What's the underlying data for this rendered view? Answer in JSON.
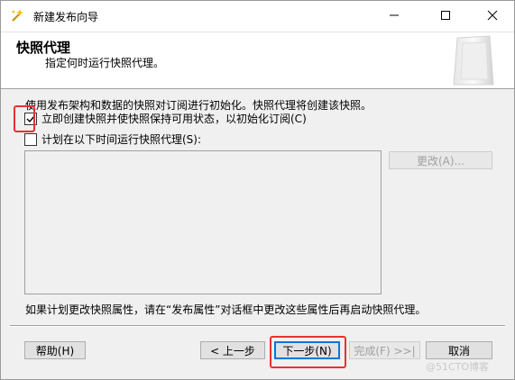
{
  "window": {
    "title": "新建发布向导"
  },
  "titlebar": {
    "minimize_glyph": "—",
    "maximize_glyph": "☐",
    "close_glyph": "✕"
  },
  "header": {
    "title": "快照代理",
    "subtitle": "指定何时运行快照代理。"
  },
  "body": {
    "description": "使用发布架构和数据的快照对订阅进行初始化。快照代理将创建该快照。",
    "options": [
      {
        "label": "立即创建快照并使快照保持可用状态，以初始化订阅(C)",
        "checked": true
      },
      {
        "label": "计划在以下时间运行快照代理(S):",
        "checked": false
      }
    ],
    "change_button": "更改(A)...",
    "note": "如果计划更改快照属性，请在“发布属性”对话框中更改这些属性后再启动快照代理。"
  },
  "footer": {
    "help": "帮助(H)",
    "back": "< 上一步",
    "next": "下一步(N)",
    "finish": "完成(F) >>|",
    "cancel": "取消"
  },
  "watermark": "@51CTO博客",
  "colors": {
    "highlight": "#e8322f",
    "default_button_border": "#0078d7"
  },
  "icons": {
    "app": "wizard-icon",
    "header": "document-stack-icon"
  }
}
